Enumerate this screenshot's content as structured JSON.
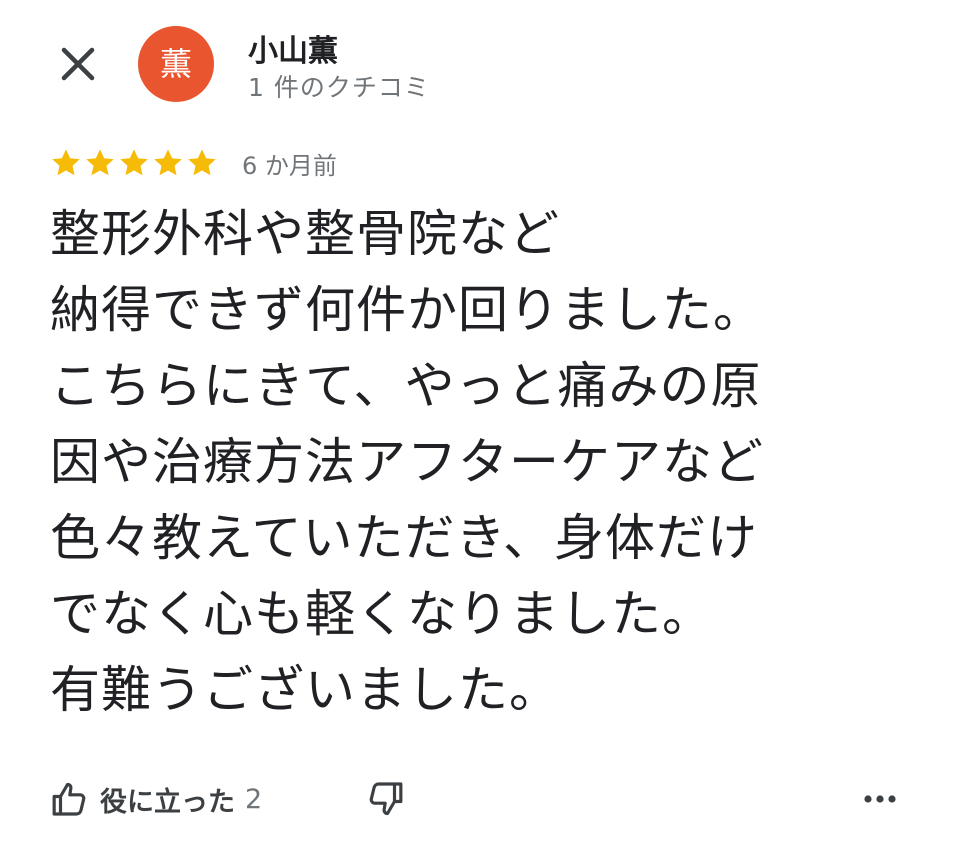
{
  "header": {
    "close_icon": "close-icon",
    "avatar": {
      "initial": "薫",
      "color": "#e8552f"
    },
    "author_name": "小山薫",
    "author_meta": "1 件のクチコミ"
  },
  "review": {
    "rating": 5,
    "max_rating": 5,
    "star_color": "#f6bb06",
    "time": "6 か月前",
    "lines": [
      "整形外科や整骨院など",
      "納得できず何件か回りました。",
      "こちらにきて、やっと痛みの原",
      "因や治療方法アフターケアなど",
      "色々教えていただき、身体だけ",
      "でなく心も軽くなりました。",
      "有難うございました。"
    ]
  },
  "footer": {
    "helpful_icon": "thumbs-up-icon",
    "helpful_label": "役に立った",
    "helpful_count": "2",
    "not_helpful_icon": "thumbs-down-icon",
    "more_icon": "more-horizontal-icon"
  }
}
